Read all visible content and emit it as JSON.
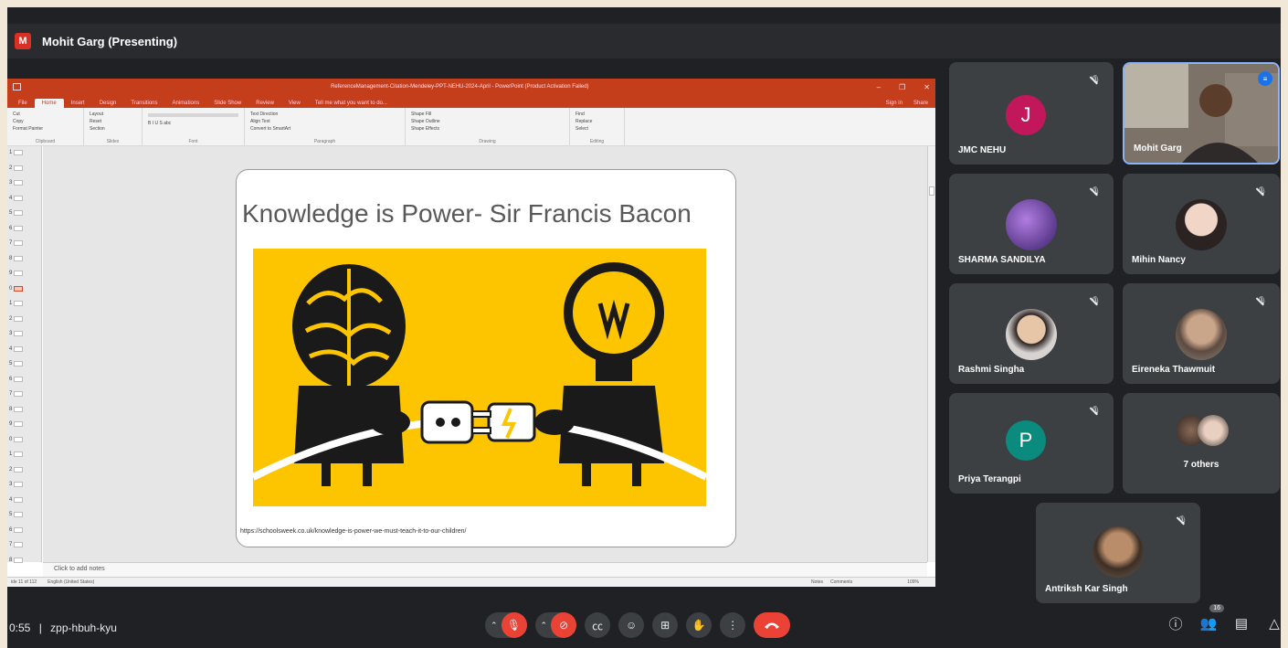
{
  "meeting": {
    "presenter_badge": "M",
    "presenting_label": "Mohit Garg (Presenting)",
    "time_partial": "0:55",
    "separator": "|",
    "meeting_code": "zpp-hbuh-kyu",
    "participant_count": "16"
  },
  "powerpoint": {
    "window_title": "ReferenceManagement-Citation-Mendeley-PPT-NEHU-2024-April - PowerPoint (Product Activation Failed)",
    "tabs": [
      "File",
      "Home",
      "Insert",
      "Design",
      "Transitions",
      "Animations",
      "Slide Show",
      "Review",
      "View"
    ],
    "active_tab": "Home",
    "tell_me": "Tell me what you want to do...",
    "sign_in": "Sign in",
    "share": "Share",
    "ribbon_groups": [
      {
        "label": "Clipboard",
        "items": [
          "Cut",
          "Copy",
          "Format Painter"
        ]
      },
      {
        "label": "Slides",
        "items": [
          "Layout",
          "Reset",
          "Section"
        ]
      },
      {
        "label": "Font",
        "items": [
          "B  I  U  S  abc"
        ]
      },
      {
        "label": "Paragraph",
        "items": [
          "Text Direction",
          "Align Text",
          "Convert to SmartArt"
        ]
      },
      {
        "label": "Drawing",
        "items": [
          "Shape Fill",
          "Shape Outline",
          "Shape Effects"
        ]
      },
      {
        "label": "Editing",
        "items": [
          "Find",
          "Replace",
          "Select"
        ]
      }
    ],
    "thumb_numbers": [
      "1",
      "2",
      "3",
      "4",
      "5",
      "6",
      "7",
      "8",
      "9",
      "0",
      "1",
      "2",
      "3",
      "4",
      "5",
      "6",
      "7",
      "8",
      "9",
      "0",
      "1",
      "2",
      "3",
      "4",
      "5",
      "6",
      "7",
      "8"
    ],
    "notes_placeholder": "Click to add notes",
    "status_left": "ide 11 of 112",
    "status_lang": "English (United States)",
    "status_notes": "Notes",
    "status_comments": "Comments",
    "zoom": "109%"
  },
  "slide": {
    "title": "Knowledge is Power- Sir Francis Bacon",
    "url": "https://schoolsweek.co.uk/knowledge-is-power-we-must-teach-it-to-our-children/"
  },
  "participants": [
    {
      "name": "JMC NEHU",
      "initial": "J",
      "color": "#c2185b",
      "muted": true
    },
    {
      "name": "Mohit Garg",
      "speaking": true
    },
    {
      "name": "SHARMA SANDILYA",
      "muted": true
    },
    {
      "name": "Mihin Nancy",
      "muted": true
    },
    {
      "name": "Rashmi Singha",
      "muted": true
    },
    {
      "name": "Eireneka Thawmuit",
      "muted": true
    },
    {
      "name": "Priya Terangpi",
      "initial": "P",
      "color": "#0b8a7e",
      "muted": true
    },
    {
      "name": "7 others"
    },
    {
      "name": "Antriksh Kar Singh",
      "muted": true
    }
  ],
  "icons": {
    "mic": "mic-off-icon",
    "camera": "camera-off-icon",
    "captions": "captions-icon",
    "emoji": "emoji-icon",
    "present": "present-icon",
    "hand": "raise-hand-icon",
    "more": "more-icon",
    "end": "end-call-icon",
    "info": "info-icon",
    "people": "people-icon",
    "chat": "chat-icon",
    "activities": "activities-icon"
  },
  "colors": {
    "powerpoint_red": "#c43e1c",
    "meet_bg": "#202124",
    "tile_bg": "#3c4043",
    "end_red": "#ea4335",
    "slide_yellow": "#fcc500"
  }
}
